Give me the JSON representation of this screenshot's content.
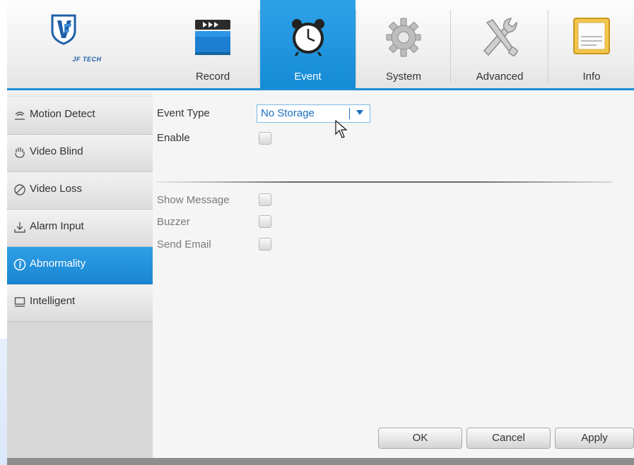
{
  "brand": {
    "logo_text": "JF TECH"
  },
  "tabs": [
    {
      "label": "Record",
      "icon": "clapperboard-icon",
      "active": false
    },
    {
      "label": "Event",
      "icon": "alarm-clock-icon",
      "active": true
    },
    {
      "label": "System",
      "icon": "gear-icon",
      "active": false
    },
    {
      "label": "Advanced",
      "icon": "tools-icon",
      "active": false
    },
    {
      "label": "Info",
      "icon": "info-panel-icon",
      "active": false
    }
  ],
  "sidebar": {
    "items": [
      {
        "label": "Motion Detect",
        "icon": "motion-detect-icon",
        "active": false
      },
      {
        "label": "Video Blind",
        "icon": "hand-icon",
        "active": false
      },
      {
        "label": "Video Loss",
        "icon": "prohibited-icon",
        "active": false
      },
      {
        "label": "Alarm Input",
        "icon": "download-arrow-icon",
        "active": false
      },
      {
        "label": "Abnormality",
        "icon": "info-circle-icon",
        "active": true
      },
      {
        "label": "Intelligent",
        "icon": "monitor-icon",
        "active": false
      }
    ]
  },
  "form": {
    "event_type_label": "Event Type",
    "event_type_value": "No Storage",
    "enable_label": "Enable",
    "show_message_label": "Show Message",
    "buzzer_label": "Buzzer",
    "send_email_label": "Send Email"
  },
  "buttons": {
    "ok": "OK",
    "cancel": "Cancel",
    "apply": "Apply"
  },
  "colors": {
    "accent": "#1d8ed6",
    "active_tab": "#2ea1e8",
    "select_text": "#1a6fc0"
  }
}
